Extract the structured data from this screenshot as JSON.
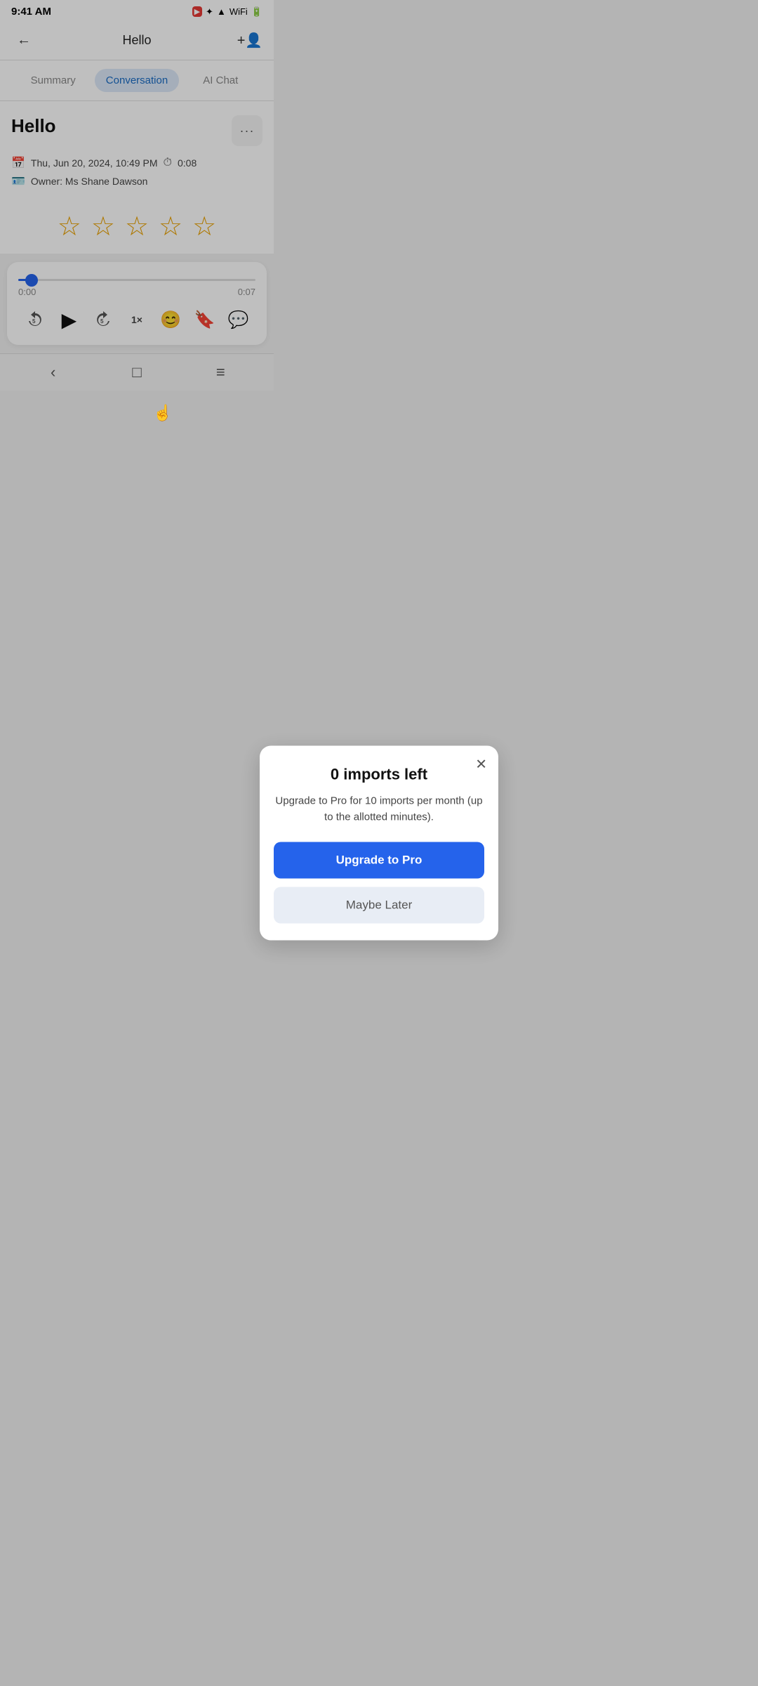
{
  "statusBar": {
    "time": "9:41 AM",
    "icons": [
      "camera",
      "bluetooth",
      "signal",
      "wifi",
      "battery"
    ]
  },
  "topNav": {
    "backLabel": "←",
    "title": "Hello",
    "addPersonLabel": "＋👤"
  },
  "tabs": [
    {
      "id": "summary",
      "label": "Summary",
      "active": false
    },
    {
      "id": "conversation",
      "label": "Conversation",
      "active": true
    },
    {
      "id": "ai-chat",
      "label": "AI Chat",
      "active": false
    }
  ],
  "record": {
    "title": "Hello",
    "moreLabel": "···",
    "date": "Thu, Jun 20, 2024, 10:49 PM",
    "duration": "0:08",
    "owner": "Owner: Ms Shane Dawson"
  },
  "modal": {
    "closeLabel": "✕",
    "title": "0 imports left",
    "description": "Upgrade to Pro for 10 imports per month (up to the allotted minutes).",
    "upgradeLabel": "Upgrade to Pro",
    "laterLabel": "Maybe Later"
  },
  "stars": {
    "items": [
      "★",
      "★",
      "★",
      "★",
      "★"
    ]
  },
  "audioPlayer": {
    "currentTime": "0:00",
    "totalTime": "0:07",
    "progressPercent": 3,
    "controls": {
      "rewindLabel": "↺5",
      "playLabel": "▶",
      "forwardLabel": "↻5",
      "speedLabel": "1×",
      "emojiLabel": "😊+",
      "bookmarkLabel": "🔖",
      "chatLabel": "💬"
    }
  },
  "bottomNav": {
    "backLabel": "‹",
    "homeLabel": "□",
    "menuLabel": "≡"
  }
}
